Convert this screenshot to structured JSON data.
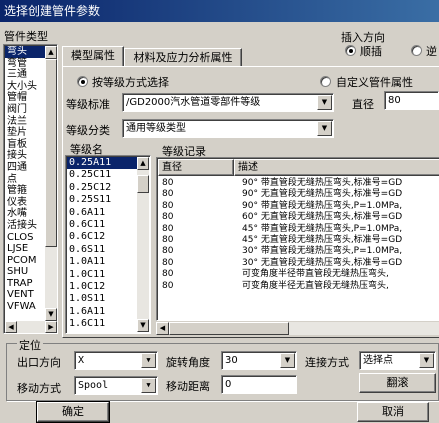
{
  "window": {
    "title": "选择创建管件参数"
  },
  "left": {
    "label": "管件类型",
    "items": [
      "弯头",
      "弯管",
      "三通",
      "大小头",
      "管帽",
      "阀门",
      "法兰",
      "垫片",
      "盲板",
      "接头",
      "四通",
      "点",
      "管箍",
      "仪表",
      "水嘴",
      "活接头",
      "CLOS",
      "LJSE",
      "PCOM",
      "SHU",
      "TRAP",
      "VENT",
      "VFWA"
    ],
    "selected_index": 0
  },
  "tabs": [
    {
      "label": "模型属性",
      "active": true
    },
    {
      "label": "材料及应力分析属性",
      "active": false
    }
  ],
  "insert": {
    "label": "插入方向",
    "options": [
      "顺插",
      "逆"
    ],
    "selected_index": 0
  },
  "mode": {
    "by_grade_label": "按等级方式选择",
    "custom_label": "自定义管件属性",
    "selected": "by_grade"
  },
  "grade_standard": {
    "label": "等级标准",
    "value": "/GD2000汽水管道零部件等级"
  },
  "diameter": {
    "label": "直径",
    "value": "80"
  },
  "grade_class": {
    "label": "等级分类",
    "value": "通用等级类型"
  },
  "grade_names": {
    "label": "等级名",
    "items": [
      "0.25A11",
      "0.25C11",
      "0.25C12",
      "0.25S11",
      "0.6A11",
      "0.6C11",
      "0.6C12",
      "0.6S11",
      "1.0A11",
      "1.0C11",
      "1.0C12",
      "1.0S11",
      "1.6A11",
      "1.6C11"
    ],
    "selected_index": 0
  },
  "grade_records": {
    "label": "等级记录",
    "columns": [
      "直径",
      "描述"
    ],
    "rows": [
      {
        "diameter": "80",
        "desc": "90° 带直管段无缝热压弯头,标准号=GD"
      },
      {
        "diameter": "80",
        "desc": "90° 无直管段无缝热压弯头,标准号=GD"
      },
      {
        "diameter": "80",
        "desc": "90° 带直管段无缝热压弯头,P=1.0MPa,"
      },
      {
        "diameter": "80",
        "desc": "60° 无直管段无缝热压弯头,标准号=GD"
      },
      {
        "diameter": "80",
        "desc": "45° 带直管段无缝热压弯头,P=1.0MPa,"
      },
      {
        "diameter": "80",
        "desc": "45° 无直管段无缝热压弯头,标准号=GD"
      },
      {
        "diameter": "80",
        "desc": "30° 带直管段无缝热压弯头,P=1.0MPa,"
      },
      {
        "diameter": "80",
        "desc": "30° 无直管段无缝热压弯头,标准号=GD"
      },
      {
        "diameter": "80",
        "desc": "可变角度半径带直管段无缝热压弯头,"
      },
      {
        "diameter": "80",
        "desc": "可变角度半径无直管段无缝热压弯头,"
      }
    ]
  },
  "positioning": {
    "label": "定位",
    "exit_dir": {
      "label": "出口方向",
      "value": "X"
    },
    "rotation": {
      "label": "旋转角度",
      "value": "30"
    },
    "connection": {
      "label": "连接方式",
      "value": "选择点"
    },
    "move_mode": {
      "label": "移动方式",
      "value": "Spool"
    },
    "move_dist": {
      "label": "移动距离",
      "value": "0"
    },
    "flip_button": "翻滚"
  },
  "buttons": {
    "ok": "确定",
    "cancel": "取消"
  }
}
